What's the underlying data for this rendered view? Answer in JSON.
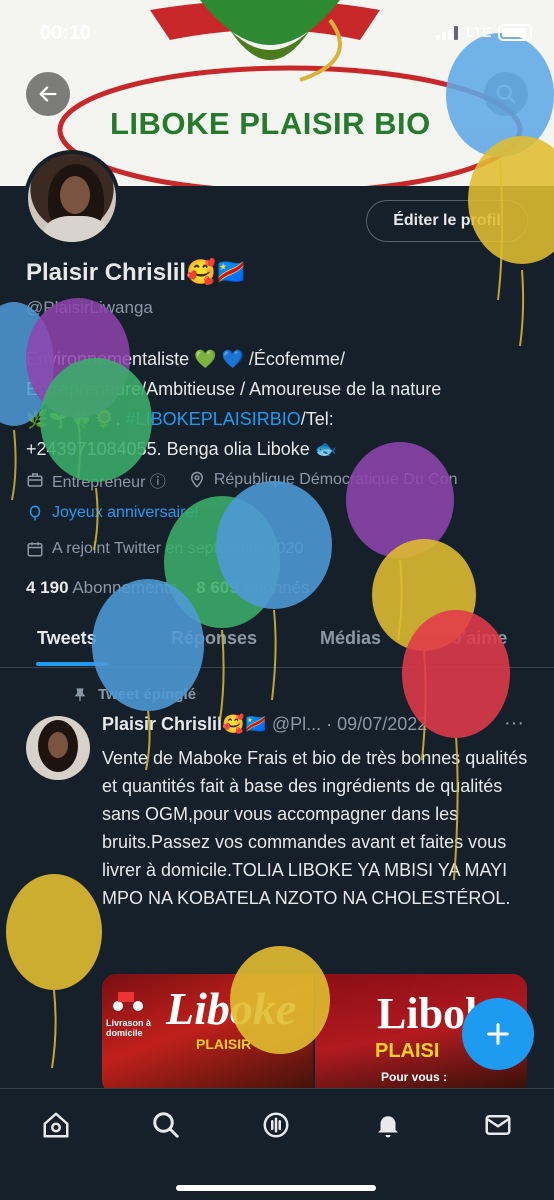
{
  "status_bar": {
    "time": "00:10",
    "network": "LTE"
  },
  "banner": {
    "title": "LIBOKE PLAISIR BIO"
  },
  "profile": {
    "edit_label": "Éditer le profil",
    "name": "Plaisir Chrislil🥰🇨🇩",
    "handle": "@PlaisirLiwanga",
    "bio_line1": "Environnementaliste 💚 💙 /Écofemme/",
    "bio_line2": "Entrepreneure/Ambitieuse / Amoureuse de la nature",
    "bio_line3_pre": "🌿🌱🍀🌻. ",
    "bio_hashtag": "#LIBOKEPLAISIRBIO",
    "bio_line3_post": "/Tel:",
    "bio_line4": "+243971084055. Benga olia Liboke 🐟",
    "category": "Entrepreneur ⓘ",
    "location": "République Démocratique Du Con",
    "birthday": "Joyeux anniversaire!",
    "joined": "A rejoint Twitter en septembre 2020",
    "following_count": "4 190",
    "following_label": "Abonnements",
    "followers_count": "8 609",
    "followers_label": "Abonnés"
  },
  "tabs": [
    "Tweets",
    "Réponses",
    "Médias",
    "J'aime"
  ],
  "tweet": {
    "pinned_label": "Tweet épinglé",
    "author": "Plaisir Chrislil🥰🇨🇩",
    "meta": "@Pl... · 09/07/2022",
    "text": "Vente de Maboke Frais et bio de très bonnes qualités et quantités fait à base des ingrédients de qualités sans OGM,pour vous accompagner dans les bruits.Passez vos commandes avant et faites vous livrer à domicile.TOLIA LIBOKE YA MBISI YA MAYI MPO NA KOBATELA NZOTO NA CHOLESTÉROL.",
    "media1_title": "Liboke",
    "media1_sub": "PLAISIR",
    "media1_delivery": "Livrason à domicile",
    "media2_title": "Libok",
    "media2_sub": "PLAISI",
    "media2_extra": "Pour vous :"
  },
  "icons": {
    "back": "arrow-left-icon",
    "search": "search-icon",
    "fab": "plus-icon",
    "nav": [
      "home-icon",
      "search-icon",
      "spaces-icon",
      "bell-icon",
      "mail-icon"
    ]
  },
  "colors": {
    "accent": "#1d9bf0",
    "background": "#15202b",
    "muted": "#8b98a5"
  }
}
